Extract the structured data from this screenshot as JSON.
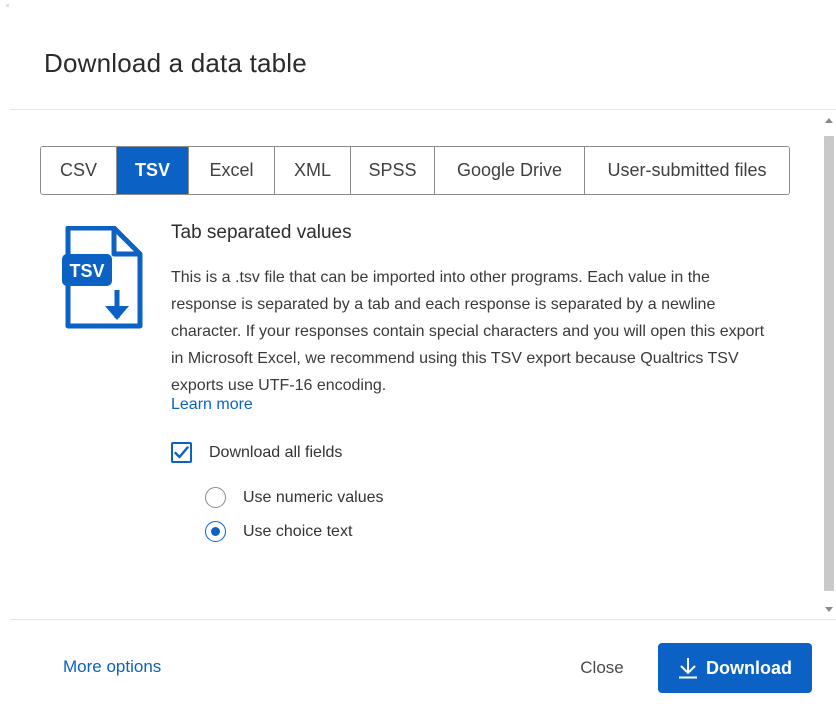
{
  "dialog": {
    "title": "Download a data table"
  },
  "tabs": [
    {
      "label": "CSV",
      "active": false
    },
    {
      "label": "TSV",
      "active": true
    },
    {
      "label": "Excel",
      "active": false
    },
    {
      "label": "XML",
      "active": false
    },
    {
      "label": "SPSS",
      "active": false
    },
    {
      "label": "Google Drive",
      "active": false
    },
    {
      "label": "User-submitted files",
      "active": false
    }
  ],
  "format": {
    "icon_label": "TSV",
    "title": "Tab separated values",
    "description": "This is a .tsv file that can be imported into other programs. Each value in the response is separated by a tab and each response is separated by a newline character. If your responses contain special characters and you will open this export in Microsoft Excel, we recommend using this TSV export because Qualtrics TSV exports use UTF-16 encoding.",
    "learn_more": "Learn more"
  },
  "options": {
    "download_all_fields": {
      "label": "Download all fields",
      "checked": true
    },
    "radios": [
      {
        "label": "Use numeric values",
        "selected": false
      },
      {
        "label": "Use choice text",
        "selected": true
      }
    ]
  },
  "footer": {
    "more_options": "More options",
    "close": "Close",
    "download": "Download"
  },
  "colors": {
    "accent": "#0b62c4",
    "text": "#32363a",
    "border": "#8c8c8c"
  },
  "icons": {
    "file": "tsv-file-download-icon",
    "check": "checkmark-icon",
    "download": "download-arrow-icon"
  }
}
